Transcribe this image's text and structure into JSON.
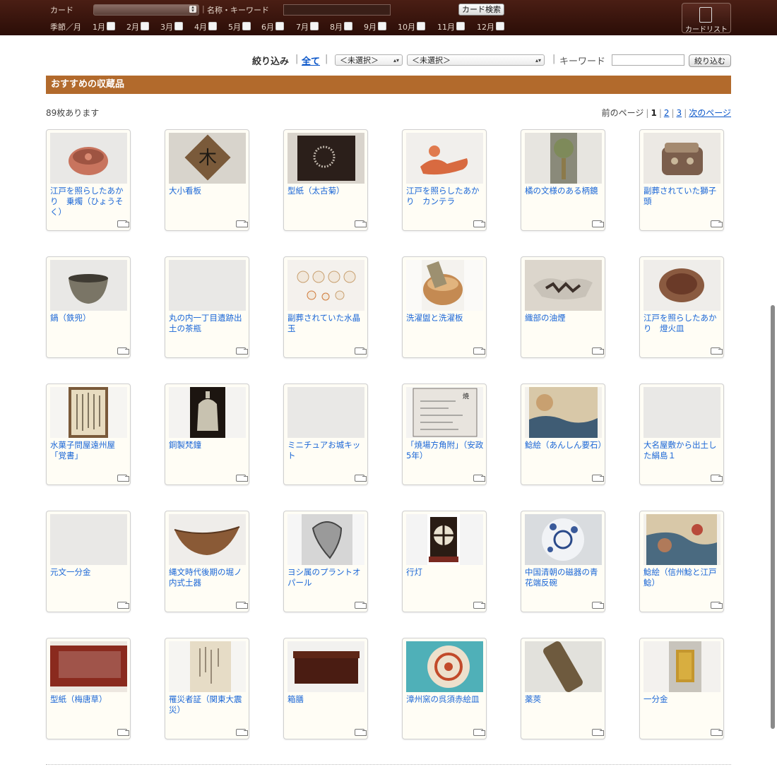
{
  "topbar": {
    "card_label": "カード",
    "name_label": "名称・キーワード",
    "search_button": "カード検索",
    "season_label": "季節／月",
    "months": [
      "1月",
      "2月",
      "3月",
      "4月",
      "5月",
      "6月",
      "7月",
      "8月",
      "9月",
      "10月",
      "11月",
      "12月"
    ],
    "cardlist_button": "カードリスト"
  },
  "filter": {
    "label": "絞り込み",
    "all": "全て",
    "select1": "＜未選択＞",
    "select2": "＜未選択＞",
    "keyword_label": "キーワード",
    "button": "絞り込む"
  },
  "section": {
    "title": "おすすめの収蔵品",
    "count": "89枚あります",
    "pager": {
      "prev": "前のページ",
      "pages": [
        "1",
        "2",
        "3"
      ],
      "next": "次のページ"
    }
  },
  "items": [
    {
      "title": "江戸を照らしたあかり　乗燭（ひょうそく）",
      "thumb": "bowl-red"
    },
    {
      "title": "大小看板",
      "thumb": "sign"
    },
    {
      "title": "型紙（太古菊）",
      "thumb": "stencil-dark"
    },
    {
      "title": "江戸を照らしたあかり　カンテラ",
      "thumb": "lamp-clay"
    },
    {
      "title": "橘の文様のある柄鏡",
      "thumb": "mirror"
    },
    {
      "title": "副葬されていた獅子頭",
      "thumb": "lion-head"
    },
    {
      "title": "鍋（鉄兜）",
      "thumb": "bowl-grey"
    },
    {
      "title": "丸の内一丁目遺跡出土の茶瓶",
      "thumb": "blank"
    },
    {
      "title": "副葬されていた水晶玉",
      "thumb": "crystals"
    },
    {
      "title": "洗濯盥と洗濯板",
      "thumb": "tub"
    },
    {
      "title": "織部の油煙",
      "thumb": "oribe"
    },
    {
      "title": "江戸を照らしたあかり　燈火皿",
      "thumb": "dish"
    },
    {
      "title": "水菓子問屋遠州屋「覚書」",
      "thumb": "document"
    },
    {
      "title": "銅製梵鐘",
      "thumb": "bell"
    },
    {
      "title": "ミニチュアお城キット",
      "thumb": "blank"
    },
    {
      "title": "「焼場方角附」（安政5年）",
      "thumb": "print"
    },
    {
      "title": "鯰絵（あんしん要石）",
      "thumb": "ukiyoe"
    },
    {
      "title": "大名屋敷から出土した絹島１",
      "thumb": "blank"
    },
    {
      "title": "元文一分金",
      "thumb": "blank"
    },
    {
      "title": "縄文時代後期の堀ノ内式土器",
      "thumb": "pottery"
    },
    {
      "title": "ヨシ属のプラントオパール",
      "thumb": "opal"
    },
    {
      "title": "行灯",
      "thumb": "andon"
    },
    {
      "title": "中国清朝の磁器の青花端反碗",
      "thumb": "porcelain"
    },
    {
      "title": "鯰絵（信州鯰と江戸鯰）",
      "thumb": "ukiyoe2"
    },
    {
      "title": "型紙（梅唐草）",
      "thumb": "stencil-red"
    },
    {
      "title": "罹災者証（関東大震災）",
      "thumb": "certificate"
    },
    {
      "title": "箱膳",
      "thumb": "box"
    },
    {
      "title": "漳州窯の呉須赤絵皿",
      "thumb": "plate"
    },
    {
      "title": "薬莢",
      "thumb": "shell"
    },
    {
      "title": "一分金",
      "thumb": "gold"
    }
  ]
}
